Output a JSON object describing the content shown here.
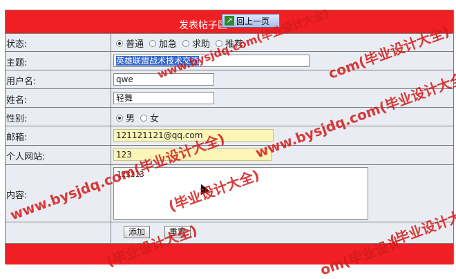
{
  "header": {
    "title": "发表帖子区",
    "back_button": "回上一页"
  },
  "form": {
    "status_label": "状态:",
    "status_options": [
      "普通",
      "加急",
      "求助",
      "推荐"
    ],
    "status_selected": "普通",
    "subject_label": "主题:",
    "subject_value": "英雄联盟战术技术交流",
    "username_label": "用户名:",
    "username_value": "qwe",
    "name_label": "姓名:",
    "name_value": "轻舞",
    "gender_label": "性别:",
    "gender_options": [
      "男",
      "女"
    ],
    "gender_selected": "男",
    "email_label": "邮箱:",
    "email_value": "121121121@qq.com",
    "website_label": "个人网站:",
    "website_value": "123",
    "content_label": "内容:",
    "content_value": "123213",
    "add_button": "添加",
    "reset_button": "重置"
  },
  "watermarks": [
    "www.bysjdq.com(毕业设计大全)",
    "www.bysjdq.com(毕业设计大全)",
    "www.bysjdq.com(毕业设计大全)",
    "(毕业设计大全)",
    "com(毕业设计大全)",
    "(毕业设计大全)",
    "(毕业设计大全)",
    "om(毕业设计"
  ],
  "colors": {
    "header_red": "#ef1f23",
    "panel_bg": "#e9edf3",
    "highlight_yellow": "#fbf6b8",
    "watermark_red": "#d41a1a"
  }
}
